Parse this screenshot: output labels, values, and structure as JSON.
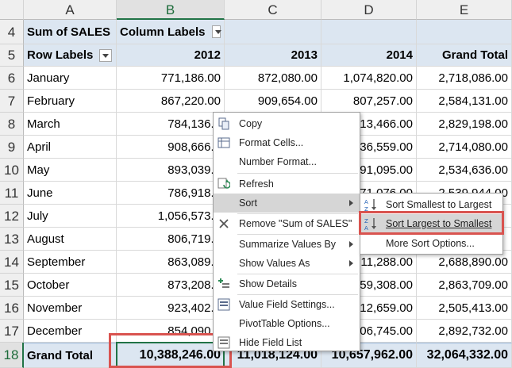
{
  "columns": [
    "A",
    "B",
    "C",
    "D",
    "E"
  ],
  "row_numbers": [
    "4",
    "5",
    "6",
    "7",
    "8",
    "9",
    "10",
    "11",
    "12",
    "13",
    "14",
    "15",
    "16",
    "17",
    "18"
  ],
  "pivot_header": {
    "sum_label": "Sum of SALES",
    "column_labels": "Column Labels",
    "row_labels": "Row Labels",
    "years": [
      "2012",
      "2013",
      "2014"
    ],
    "grand_total_header": "Grand Total"
  },
  "rows": [
    {
      "label": "January",
      "b": "771,186.00",
      "c": "872,080.00",
      "d": "1,074,820.00",
      "e": "2,718,086.00"
    },
    {
      "label": "February",
      "b": "867,220.00",
      "c": "909,654.00",
      "d": "807,257.00",
      "e": "2,584,131.00"
    },
    {
      "label": "March",
      "b": "784,136.0",
      "c": "",
      "d": "13,466.00",
      "e": "2,829,198.00"
    },
    {
      "label": "April",
      "b": "908,666.0",
      "c": "",
      "d": "36,559.00",
      "e": "2,714,080.00"
    },
    {
      "label": "May",
      "b": "893,039.0",
      "c": "",
      "d": "91,095.00",
      "e": "2,534,636.00"
    },
    {
      "label": "June",
      "b": "786,918.0",
      "c": "",
      "d": "71,076.00",
      "e": "2,539,944.00"
    },
    {
      "label": "July",
      "b": "1,056,573.0",
      "c": "",
      "d": "",
      "e": ""
    },
    {
      "label": "August",
      "b": "806,719.0",
      "c": "",
      "d": "",
      "e": ""
    },
    {
      "label": "September",
      "b": "863,089.0",
      "c": "",
      "d": "11,288.00",
      "e": "2,688,890.00"
    },
    {
      "label": "October",
      "b": "873,208.0",
      "c": "",
      "d": "59,308.00",
      "e": "2,863,709.00"
    },
    {
      "label": "November",
      "b": "923,402.0",
      "c": "",
      "d": "12,659.00",
      "e": "2,505,413.00"
    },
    {
      "label": "December",
      "b": "854,090.0",
      "c": "",
      "d": "06,745.00",
      "e": "2,892,732.00"
    }
  ],
  "grand_total": {
    "label": "Grand Total",
    "b": "10,388,246.00",
    "c": "11,018,124.00",
    "d": "10,657,962.00",
    "e": "32,064,332.00"
  },
  "context_menu": {
    "items": [
      {
        "label": "Copy",
        "icon": "copy-icon"
      },
      {
        "label": "Format Cells...",
        "icon": "format-cells-icon"
      },
      {
        "label": "Number Format...",
        "icon": ""
      },
      {
        "label": "Refresh",
        "icon": "refresh-icon"
      },
      {
        "label": "Sort",
        "icon": "",
        "submenu": true
      },
      {
        "label": "Remove \"Sum of SALES\"",
        "icon": "remove-icon"
      },
      {
        "label": "Summarize Values By",
        "icon": "",
        "submenu": true
      },
      {
        "label": "Show Values As",
        "icon": "",
        "submenu": true
      },
      {
        "label": "Show Details",
        "icon": "show-details-icon"
      },
      {
        "label": "Value Field Settings...",
        "icon": "value-field-settings-icon"
      },
      {
        "label": "PivotTable Options...",
        "icon": ""
      },
      {
        "label": "Hide Field List",
        "icon": "field-list-icon"
      }
    ]
  },
  "sort_submenu": {
    "items": [
      {
        "label": "Sort Smallest to Largest",
        "icon": "sort-ascending-icon"
      },
      {
        "label": "Sort Largest to Smallest",
        "icon": "sort-descending-icon"
      },
      {
        "label": "More Sort Options...",
        "icon": ""
      }
    ]
  },
  "colors": {
    "pivot_header_bg": "#dce6f1",
    "selection_green": "#217346",
    "highlight_red": "#d9534f",
    "menu_highlight": "#d6d6d6"
  }
}
